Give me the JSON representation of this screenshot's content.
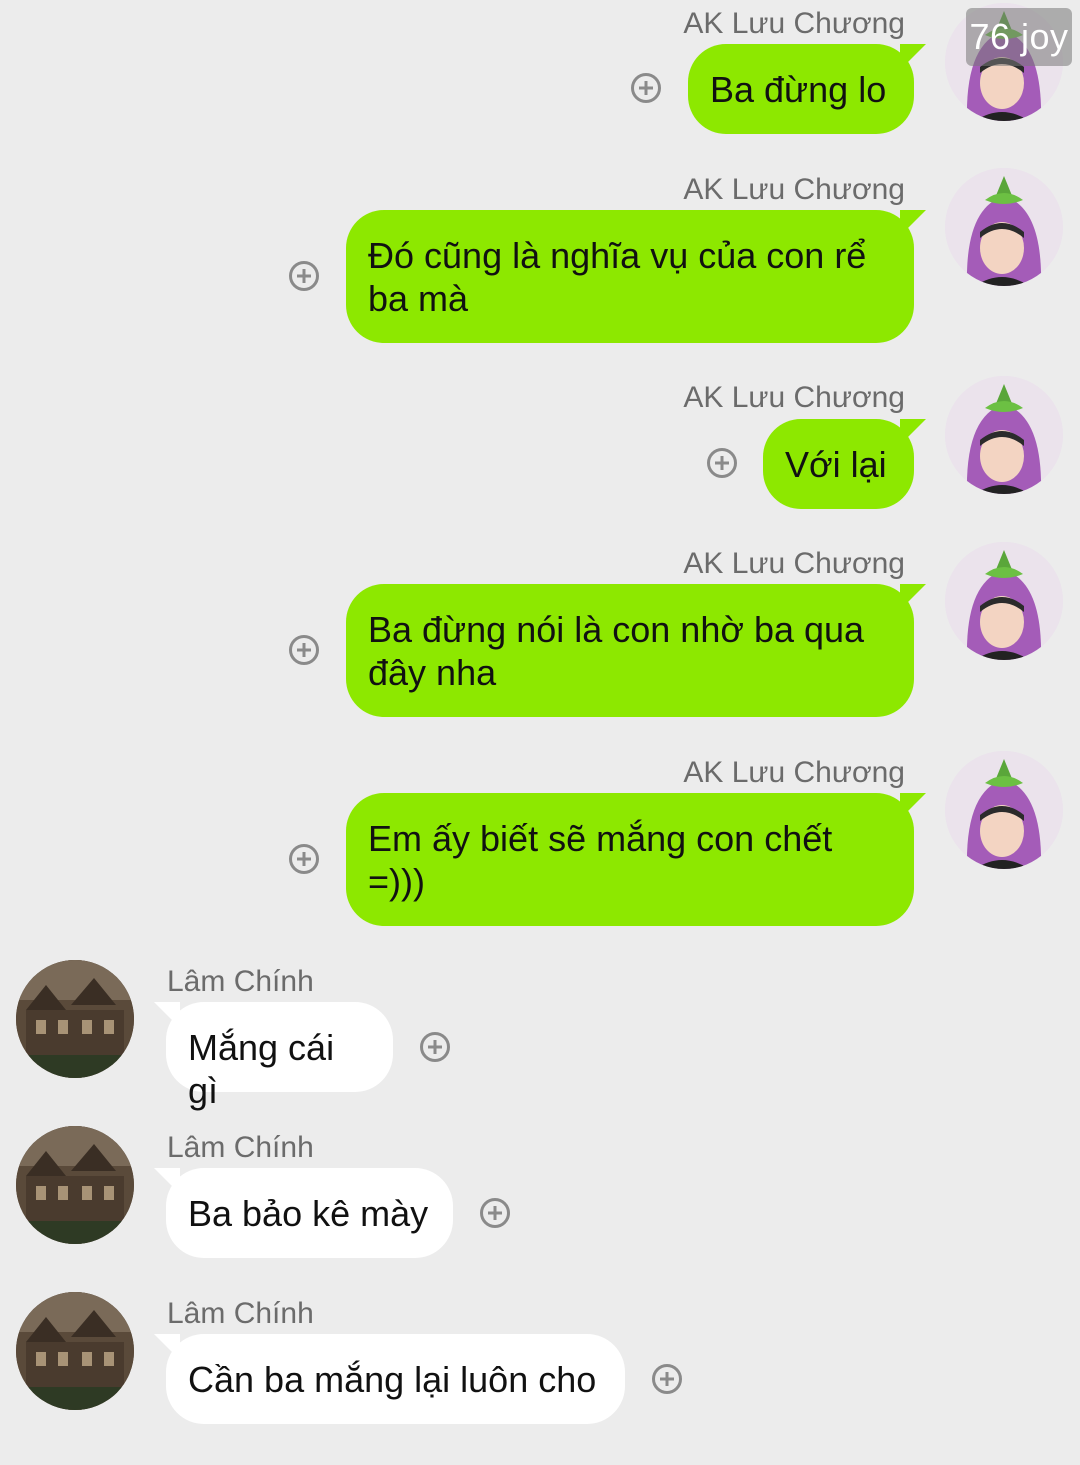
{
  "watermark": "76 joy",
  "messages": [
    {
      "side": "out",
      "sender": "AK Lưu Chương",
      "lines": [
        "Ba đừng lo"
      ]
    },
    {
      "side": "out",
      "sender": "AK Lưu Chương",
      "lines": [
        "Đó cũng là nghĩa vụ của con rể",
        "ba mà"
      ]
    },
    {
      "side": "out",
      "sender": "AK Lưu Chương",
      "lines": [
        "Với lại"
      ]
    },
    {
      "side": "out",
      "sender": "AK Lưu Chương",
      "lines": [
        "Ba đừng nói là con nhờ ba qua",
        "đây nha"
      ]
    },
    {
      "side": "out",
      "sender": "AK Lưu Chương",
      "lines": [
        "Em ấy biết sẽ mắng con chết",
        "=)))"
      ]
    },
    {
      "side": "in",
      "sender": "Lâm Chính",
      "lines": [
        "Mắng cái gì"
      ]
    },
    {
      "side": "in",
      "sender": "Lâm Chính",
      "lines": [
        "Ba bảo kê mày"
      ]
    },
    {
      "side": "in",
      "sender": "Lâm Chính",
      "lines": [
        "Cần ba mắng lại luôn cho"
      ]
    }
  ],
  "icons": {
    "add_reaction": "plus-circle-icon",
    "avatar_out": "eggplant-hat-avatar",
    "avatar_in": "mansion-avatar"
  }
}
